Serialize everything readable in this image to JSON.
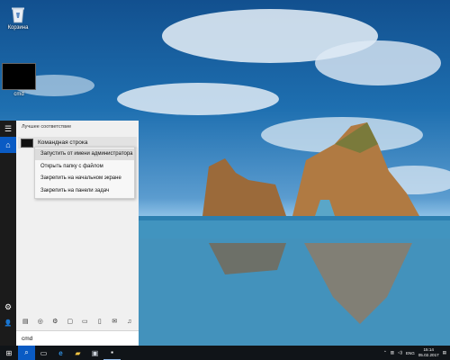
{
  "desktop": {
    "icons": [
      {
        "label": "Корзина",
        "icon": "recycle-bin-icon"
      },
      {
        "label": "cmd",
        "icon": "cmd-shortcut-icon"
      }
    ]
  },
  "start_menu": {
    "rail": {
      "menu_icon": "☰",
      "home_icon": "⌂",
      "settings_icon": "⚙",
      "user_icon": "👤"
    },
    "best_match_header": "Лучшее соответствие",
    "best_match_item": "Командная строка",
    "context_menu": [
      "Запустить от имени администратора",
      "Открыть папку с файлом",
      "Закрепить на начальном экране",
      "Закрепить на панели задач"
    ],
    "filter_icons": [
      "▤",
      "◎",
      "⚙",
      "▢",
      "▭",
      "▯",
      "✉",
      "♫"
    ],
    "search_query": "cmd"
  },
  "taskbar": {
    "start_icon": "⊞",
    "search_icon": "⌕",
    "taskview_icon": "▭",
    "edge_icon": "e",
    "explorer_icon": "▰",
    "store_icon": "▣",
    "cmd_icon": "▪",
    "tray": {
      "chevron": "⌃",
      "network": "▥",
      "volume": "◁)",
      "lang": "ENG",
      "time": "15:14",
      "date": "05.02.2017",
      "notifications": "▤"
    }
  }
}
